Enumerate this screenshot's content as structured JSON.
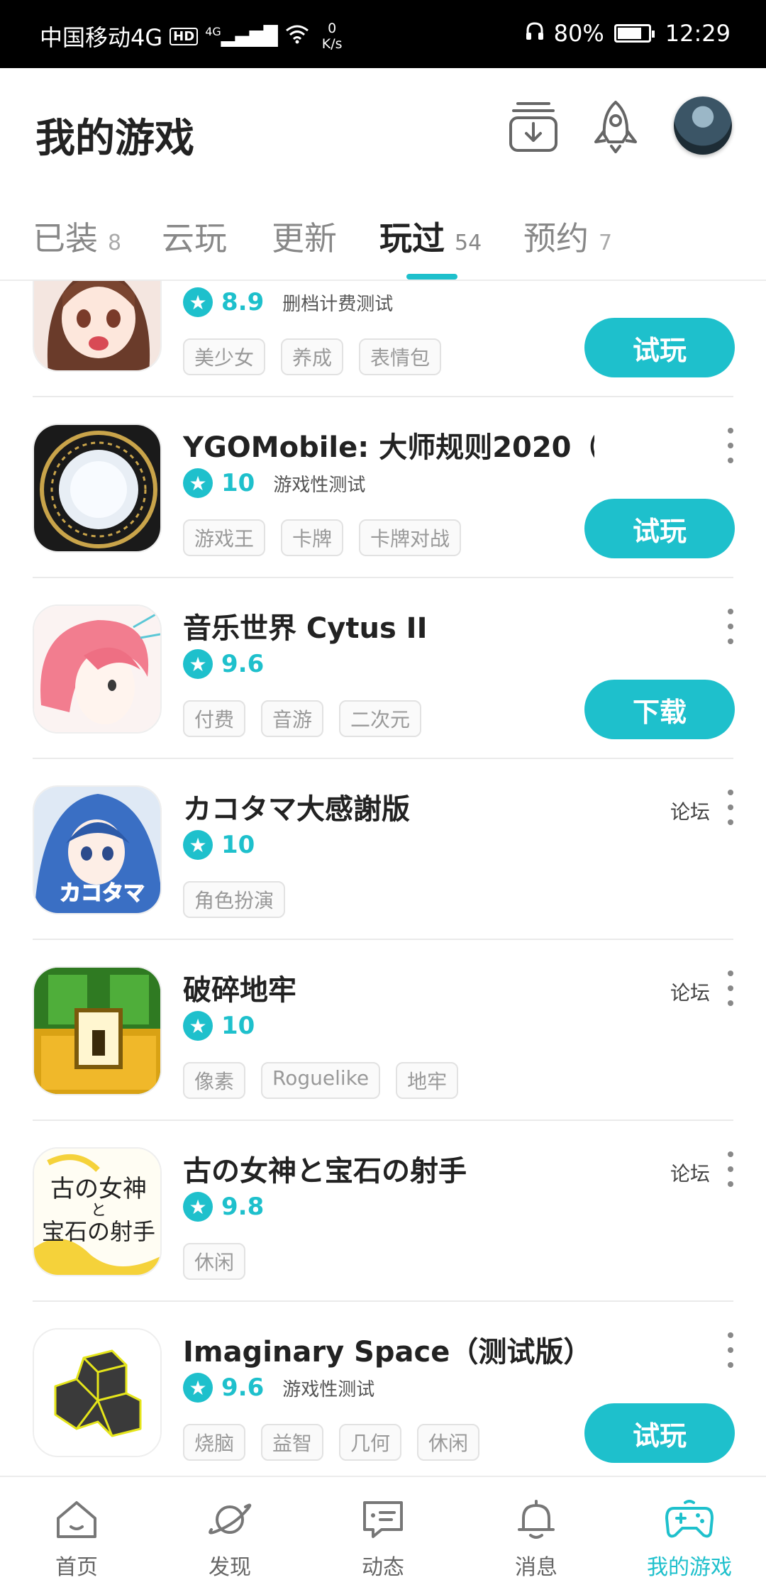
{
  "status_bar": {
    "carrier": "中国移动4G",
    "hd_badge": "HD",
    "network": "4G",
    "speed_value": "0",
    "speed_unit": "K/s",
    "battery_percent": "80%",
    "battery_level": 0.8,
    "time": "12:29"
  },
  "header": {
    "title": "我的游戏"
  },
  "tabs": [
    {
      "label": "已装",
      "count": "8",
      "active": false
    },
    {
      "label": "云玩",
      "count": "",
      "active": false
    },
    {
      "label": "更新",
      "count": "",
      "active": false
    },
    {
      "label": "玩过",
      "count": "54",
      "active": true
    },
    {
      "label": "预约",
      "count": "7",
      "active": false
    }
  ],
  "games": [
    {
      "name": "",
      "score": "8.9",
      "note": "删档计费测试",
      "tags": [
        "美少女",
        "养成",
        "表情包"
      ],
      "action": "试玩",
      "forum": "",
      "icon": "anime-girl-icon"
    },
    {
      "name": "YGOMobile: 大师规则2020（…",
      "score": "10",
      "note": "游戏性测试",
      "tags": [
        "游戏王",
        "卡牌",
        "卡牌对战"
      ],
      "action": "试玩",
      "forum": "",
      "icon": "magic-circle-icon"
    },
    {
      "name": "音乐世界 Cytus II",
      "score": "9.6",
      "note": "",
      "tags": [
        "付费",
        "音游",
        "二次元"
      ],
      "action": "下载",
      "forum": "",
      "icon": "pink-hair-girl-icon"
    },
    {
      "name": "カコタマ大感謝版",
      "score": "10",
      "note": "",
      "tags": [
        "角色扮演"
      ],
      "action": "",
      "forum": "论坛",
      "icon": "blue-hair-girl-icon"
    },
    {
      "name": "破碎地牢",
      "score": "10",
      "note": "",
      "tags": [
        "像素",
        "Roguelike",
        "地牢"
      ],
      "action": "",
      "forum": "论坛",
      "icon": "pixel-chest-icon"
    },
    {
      "name": "古の女神と宝石の射手",
      "score": "9.8",
      "note": "",
      "tags": [
        "休闲"
      ],
      "action": "",
      "forum": "论坛",
      "icon": "calligraphy-title-icon"
    },
    {
      "name": "Imaginary Space（测试版）",
      "score": "9.6",
      "note": "游戏性测试",
      "tags": [
        "烧脑",
        "益智",
        "几何",
        "休闲"
      ],
      "action": "试玩",
      "forum": "",
      "icon": "cube-shape-icon"
    }
  ],
  "icon_text": {
    "kakotama": "カコタマ",
    "goddess_line1": "古の女神",
    "goddess_line2": "と",
    "goddess_line3": "宝石の射手"
  },
  "bottom_nav": [
    {
      "label": "首页",
      "icon": "home-icon",
      "active": false
    },
    {
      "label": "发现",
      "icon": "planet-icon",
      "active": false
    },
    {
      "label": "动态",
      "icon": "chat-icon",
      "active": false
    },
    {
      "label": "消息",
      "icon": "bell-icon",
      "active": false
    },
    {
      "label": "我的游戏",
      "icon": "gamepad-icon",
      "active": true
    }
  ],
  "colors": {
    "accent": "#1ec0cc",
    "text": "#222222",
    "muted": "#999999"
  }
}
